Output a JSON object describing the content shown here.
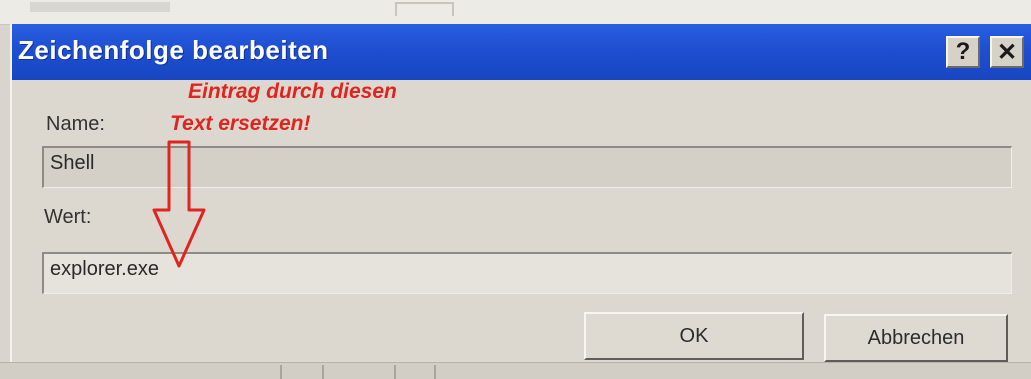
{
  "dialog": {
    "title": "Zeichenfolge bearbeiten",
    "help_label": "?",
    "close_label": "✕",
    "name_label": "Name:",
    "name_value": "Shell",
    "value_label": "Wert:",
    "value_value": "explorer.exe",
    "ok_label": "OK",
    "cancel_label": "Abbrechen"
  },
  "annotation": {
    "line1": "Eintrag durch diesen",
    "line2": "Text ersetzen!",
    "color": "#e0241f",
    "arrow_icon": "down-arrow-outline-icon"
  },
  "colors": {
    "titlebar": "#1e4fd0",
    "dialog_bg": "#dcd8cf"
  }
}
